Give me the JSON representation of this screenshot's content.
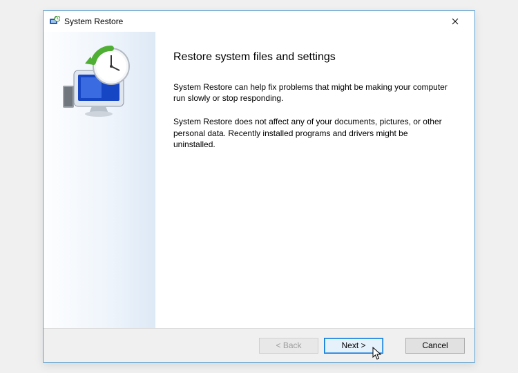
{
  "window": {
    "title": "System Restore"
  },
  "content": {
    "heading": "Restore system files and settings",
    "para1": "System Restore can help fix problems that might be making your computer run slowly or stop responding.",
    "para2": "System Restore does not affect any of your documents, pictures, or other personal data. Recently installed programs and drivers might be uninstalled."
  },
  "footer": {
    "back": "< Back",
    "next": "Next >",
    "cancel": "Cancel"
  }
}
